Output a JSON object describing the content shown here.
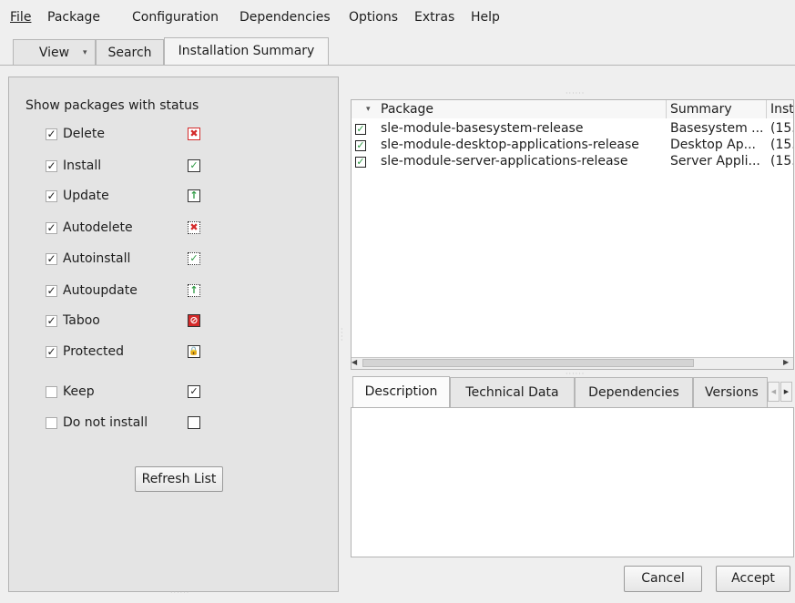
{
  "menu": [
    {
      "label": "File"
    },
    {
      "label": "Package"
    },
    {
      "label": "Configuration"
    },
    {
      "label": "Dependencies"
    },
    {
      "label": "Options"
    },
    {
      "label": "Extras"
    },
    {
      "label": "Help"
    }
  ],
  "main_tabs": {
    "view": "View",
    "search": "Search",
    "summary": "Installation Summary"
  },
  "status_panel": {
    "title": "Show packages with status",
    "items": [
      {
        "label": "Delete",
        "checked": true,
        "icon": "delete-icon"
      },
      {
        "label": "Install",
        "checked": true,
        "icon": "install-icon"
      },
      {
        "label": "Update",
        "checked": true,
        "icon": "update-icon"
      },
      {
        "label": "Autodelete",
        "checked": true,
        "icon": "autodelete-icon"
      },
      {
        "label": "Autoinstall",
        "checked": true,
        "icon": "autoinstall-icon"
      },
      {
        "label": "Autoupdate",
        "checked": true,
        "icon": "autoupdate-icon"
      },
      {
        "label": "Taboo",
        "checked": true,
        "icon": "taboo-icon"
      },
      {
        "label": "Protected",
        "checked": true,
        "icon": "protected-icon"
      },
      {
        "label": "Keep",
        "checked": false,
        "icon": "keep-icon"
      },
      {
        "label": "Do not install",
        "checked": false,
        "icon": "do-not-install-icon"
      }
    ],
    "refresh_label": "Refresh List"
  },
  "package_table": {
    "columns": [
      "Package",
      "Summary",
      "Inst"
    ],
    "rows": [
      {
        "name": "sle-module-basesystem-release",
        "summary": "Basesystem ...",
        "inst": "(15."
      },
      {
        "name": "sle-module-desktop-applications-release",
        "summary": "Desktop Ap...",
        "inst": "(15."
      },
      {
        "name": "sle-module-server-applications-release",
        "summary": "Server Appli...",
        "inst": "(15."
      }
    ]
  },
  "detail_tabs": [
    "Description",
    "Technical Data",
    "Dependencies",
    "Versions"
  ],
  "buttons": {
    "cancel": "Cancel",
    "accept": "Accept"
  },
  "colors": {
    "delete": "#d42a2a",
    "install": "#2e9a44",
    "taboo": "#d42a2a"
  }
}
